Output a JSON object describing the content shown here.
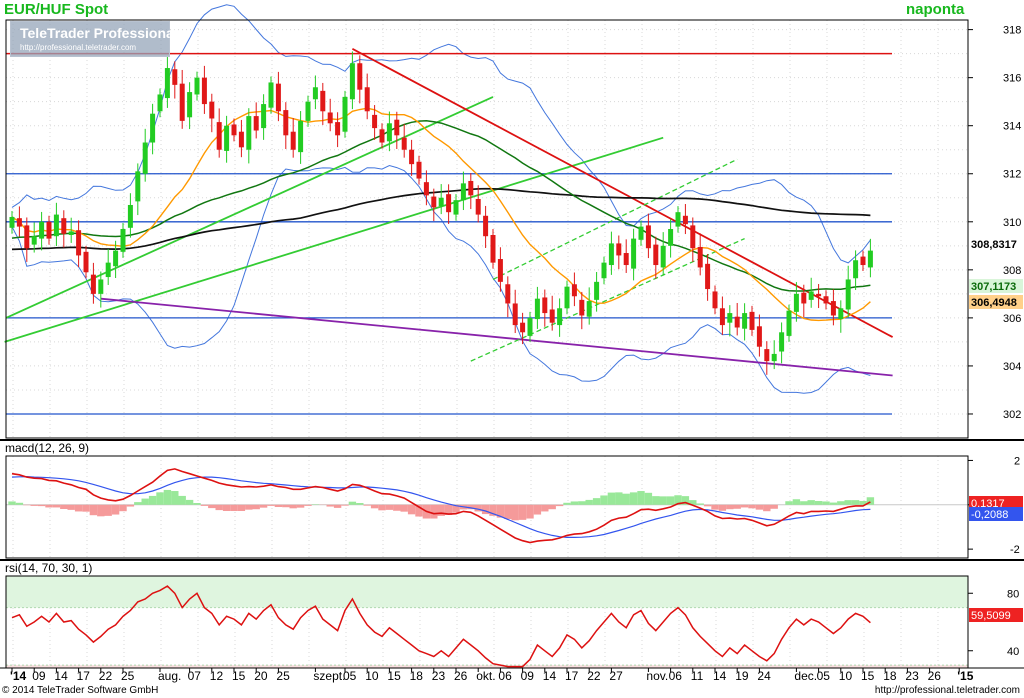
{
  "header": {
    "title": "EUR/HUF Spot",
    "period": "naponta",
    "logo_main": "TeleTrader Professional",
    "logo_url": "http://professional.teletrader.com"
  },
  "footer": {
    "copyright": "© 2014 TeleTrader Software GmbH",
    "url": "http://professional.teletrader.com"
  },
  "colors": {
    "up_candle": "#22cc22",
    "down_candle": "#e01818",
    "macd_line": "#dd1111",
    "signal_line": "#3355ee",
    "rsi_line": "#dd1111",
    "sma_fast": "#ff9900",
    "sma_mid": "#117711",
    "sma_slow": "#111111",
    "bollinger": "#4477dd",
    "resistance": "#dd1111",
    "support": "#2255cc",
    "trend_green": "#33cc33",
    "trend_purple": "#8822aa"
  },
  "chart_data": [
    {
      "id": "price",
      "type": "candlestick",
      "ylim": [
        301,
        318.4
      ],
      "y_ticks": [
        302,
        304,
        306,
        308,
        310,
        312,
        314,
        316,
        318
      ],
      "x_ticks": [
        {
          "label": "'14",
          "i": 0
        },
        {
          "label": "09",
          "i": 3
        },
        {
          "label": "14",
          "i": 6
        },
        {
          "label": "17",
          "i": 9
        },
        {
          "label": "22",
          "i": 12
        },
        {
          "label": "25",
          "i": 15
        },
        {
          "label": "aug.",
          "i": 20
        },
        {
          "label": "07",
          "i": 24
        },
        {
          "label": "12",
          "i": 27
        },
        {
          "label": "15",
          "i": 30
        },
        {
          "label": "20",
          "i": 33
        },
        {
          "label": "25",
          "i": 36
        },
        {
          "label": "szept.",
          "i": 41
        },
        {
          "label": "05",
          "i": 45
        },
        {
          "label": "10",
          "i": 48
        },
        {
          "label": "15",
          "i": 51
        },
        {
          "label": "18",
          "i": 54
        },
        {
          "label": "23",
          "i": 57
        },
        {
          "label": "26",
          "i": 60
        },
        {
          "label": "okt.",
          "i": 63
        },
        {
          "label": "06",
          "i": 66
        },
        {
          "label": "09",
          "i": 69
        },
        {
          "label": "14",
          "i": 72
        },
        {
          "label": "17",
          "i": 75
        },
        {
          "label": "22",
          "i": 78
        },
        {
          "label": "27",
          "i": 81
        },
        {
          "label": "nov.",
          "i": 86
        },
        {
          "label": "06",
          "i": 89
        },
        {
          "label": "11",
          "i": 92
        },
        {
          "label": "14",
          "i": 95
        },
        {
          "label": "19",
          "i": 98
        },
        {
          "label": "24",
          "i": 101
        },
        {
          "label": "dec.",
          "i": 106
        },
        {
          "label": "05",
          "i": 109
        },
        {
          "label": "10",
          "i": 112
        },
        {
          "label": "15",
          "i": 115
        },
        {
          "label": "18",
          "i": 118
        },
        {
          "label": "23",
          "i": 121
        },
        {
          "label": "26",
          "i": 124
        },
        {
          "label": "'15",
          "i": 128
        }
      ],
      "close": [
        310.2,
        309.8,
        308.9,
        309.4,
        310.0,
        309.3,
        310.3,
        309.5,
        309.6,
        308.6,
        307.9,
        307.0,
        307.6,
        308.3,
        308.8,
        309.7,
        310.7,
        312.1,
        313.3,
        314.5,
        315.3,
        316.4,
        315.7,
        314.2,
        315.4,
        316.0,
        314.9,
        314.3,
        313.0,
        314.0,
        313.6,
        313.1,
        314.4,
        313.8,
        314.9,
        315.8,
        314.6,
        313.6,
        313.0,
        314.2,
        315.0,
        315.6,
        314.6,
        314.1,
        313.6,
        315.2,
        316.6,
        315.5,
        314.6,
        313.9,
        313.3,
        314.1,
        313.6,
        313.0,
        312.4,
        311.8,
        311.1,
        310.6,
        311.0,
        310.4,
        310.9,
        311.6,
        311.1,
        310.3,
        309.4,
        308.3,
        307.5,
        306.6,
        305.7,
        305.4,
        306.0,
        306.8,
        306.2,
        305.8,
        306.4,
        307.3,
        306.9,
        306.1,
        306.7,
        307.5,
        308.3,
        309.1,
        308.6,
        308.2,
        309.3,
        309.8,
        308.9,
        308.2,
        309.0,
        309.7,
        310.4,
        309.9,
        308.9,
        308.1,
        307.2,
        306.4,
        305.7,
        306.2,
        305.6,
        306.2,
        305.5,
        304.8,
        304.2,
        304.5,
        305.4,
        306.3,
        307.0,
        306.6,
        307.1,
        306.9,
        306.6,
        306.1,
        306.4,
        307.6,
        308.4,
        308.2,
        308.8
      ]
    },
    {
      "id": "macd",
      "label": "macd(12, 26, 9)",
      "type": "line",
      "ylim": [
        -2.4,
        2.2
      ],
      "y_ticks": [
        -2,
        0,
        2
      ],
      "series": [
        {
          "name": "macd",
          "values": [
            1.4,
            1.35,
            1.25,
            1.2,
            1.18,
            1.1,
            1.08,
            0.98,
            0.9,
            0.78,
            0.7,
            0.45,
            0.3,
            0.22,
            0.18,
            0.25,
            0.42,
            0.62,
            0.82,
            1.02,
            1.3,
            1.55,
            1.62,
            1.5,
            1.4,
            1.3,
            1.2,
            1.1,
            0.98,
            0.9,
            0.85,
            0.8,
            0.82,
            0.8,
            0.84,
            0.9,
            0.82,
            0.78,
            0.7,
            0.7,
            0.76,
            0.82,
            0.78,
            0.7,
            0.62,
            0.72,
            0.92,
            0.88,
            0.76,
            0.62,
            0.5,
            0.48,
            0.4,
            0.3,
            0.1,
            -0.1,
            -0.3,
            -0.4,
            -0.38,
            -0.42,
            -0.4,
            -0.3,
            -0.34,
            -0.5,
            -0.7,
            -0.9,
            -1.1,
            -1.3,
            -1.5,
            -1.62,
            -1.7,
            -1.64,
            -1.6,
            -1.58,
            -1.5,
            -1.38,
            -1.32,
            -1.3,
            -1.22,
            -1.1,
            -0.92,
            -0.7,
            -0.6,
            -0.56,
            -0.4,
            -0.22,
            -0.2,
            -0.25,
            -0.18,
            -0.1,
            0.05,
            0.1,
            -0.02,
            -0.15,
            -0.3,
            -0.5,
            -0.62,
            -0.6,
            -0.64,
            -0.62,
            -0.7,
            -0.82,
            -0.95,
            -0.88,
            -0.7,
            -0.5,
            -0.35,
            -0.4,
            -0.3,
            -0.3,
            -0.28,
            -0.3,
            -0.2,
            -0.1,
            -0.05,
            -0.05,
            0.13
          ]
        },
        {
          "name": "signal",
          "values": [
            1.25,
            1.26,
            1.27,
            1.25,
            1.24,
            1.22,
            1.2,
            1.17,
            1.13,
            1.08,
            1.01,
            0.92,
            0.82,
            0.72,
            0.62,
            0.54,
            0.5,
            0.5,
            0.54,
            0.62,
            0.74,
            0.88,
            1.0,
            1.1,
            1.18,
            1.22,
            1.25,
            1.25,
            1.22,
            1.18,
            1.13,
            1.08,
            1.04,
            1.0,
            0.97,
            0.95,
            0.92,
            0.89,
            0.86,
            0.83,
            0.81,
            0.8,
            0.79,
            0.78,
            0.76,
            0.76,
            0.78,
            0.8,
            0.8,
            0.78,
            0.75,
            0.71,
            0.67,
            0.61,
            0.53,
            0.43,
            0.32,
            0.22,
            0.12,
            0.04,
            -0.04,
            -0.09,
            -0.14,
            -0.2,
            -0.28,
            -0.4,
            -0.52,
            -0.66,
            -0.8,
            -0.94,
            -1.08,
            -1.2,
            -1.3,
            -1.38,
            -1.44,
            -1.47,
            -1.47,
            -1.46,
            -1.44,
            -1.4,
            -1.34,
            -1.25,
            -1.16,
            -1.06,
            -0.96,
            -0.84,
            -0.74,
            -0.64,
            -0.56,
            -0.48,
            -0.38,
            -0.29,
            -0.23,
            -0.21,
            -0.23,
            -0.28,
            -0.35,
            -0.4,
            -0.46,
            -0.5,
            -0.54,
            -0.6,
            -0.66,
            -0.7,
            -0.7,
            -0.66,
            -0.6,
            -0.56,
            -0.51,
            -0.47,
            -0.43,
            -0.4,
            -0.36,
            -0.31,
            -0.26,
            -0.22,
            -0.21
          ]
        }
      ],
      "last_values": [
        "0,1317",
        "-0,2088"
      ]
    },
    {
      "id": "rsi",
      "label": "rsi(14, 70, 30, 1)",
      "type": "line",
      "ylim": [
        28,
        92
      ],
      "y_ticks": [
        40,
        80
      ],
      "bands": [
        70,
        30
      ],
      "series": [
        {
          "name": "rsi",
          "values": [
            63,
            65,
            57,
            60,
            64,
            60,
            66,
            60,
            61,
            55,
            51,
            46,
            50,
            55,
            58,
            64,
            68,
            74,
            76,
            80,
            82,
            85,
            80,
            70,
            76,
            80,
            70,
            66,
            58,
            64,
            62,
            58,
            66,
            62,
            68,
            72,
            63,
            58,
            55,
            63,
            68,
            71,
            62,
            58,
            54,
            68,
            76,
            66,
            58,
            53,
            50,
            56,
            52,
            48,
            44,
            40,
            38,
            36,
            40,
            36,
            42,
            48,
            44,
            40,
            35,
            31,
            30,
            29,
            29,
            29,
            34,
            44,
            40,
            36,
            42,
            51,
            48,
            42,
            47,
            54,
            60,
            66,
            60,
            56,
            65,
            68,
            59,
            54,
            60,
            66,
            70,
            65,
            56,
            50,
            45,
            40,
            36,
            42,
            38,
            44,
            40,
            36,
            33,
            38,
            48,
            56,
            62,
            58,
            62,
            60,
            56,
            52,
            56,
            62,
            66,
            64,
            59.5
          ]
        }
      ],
      "last_value": "59,5099"
    }
  ],
  "price_labels": {
    "slow_ma": "308,8317",
    "mid_ma": "307,1173",
    "fast_ma": "306,4948"
  }
}
